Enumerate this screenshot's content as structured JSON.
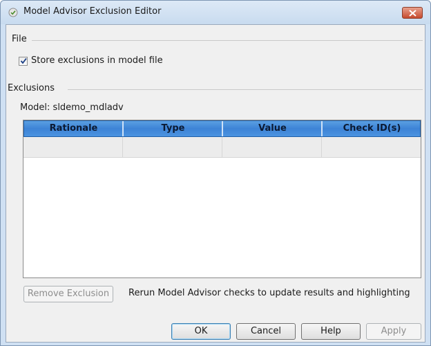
{
  "window": {
    "title": "Model Advisor Exclusion Editor",
    "accent": "#cfe0f3",
    "close_color": "#c64a2e"
  },
  "file_group": {
    "label": "File",
    "store_checkbox_label": "Store exclusions in model file",
    "store_checked": true
  },
  "exclusions_group": {
    "label": "Exclusions",
    "model_label": "Model: sldemo_mdladv",
    "columns": [
      "Rationale",
      "Type",
      "Value",
      "Check ID(s)"
    ],
    "header_color": "#3d83d6",
    "rows": []
  },
  "actions": {
    "remove_label": "Remove Exclusion",
    "hint": "Rerun Model Advisor checks to update results and highlighting"
  },
  "footer": {
    "ok": "OK",
    "cancel": "Cancel",
    "help": "Help",
    "apply": "Apply"
  }
}
